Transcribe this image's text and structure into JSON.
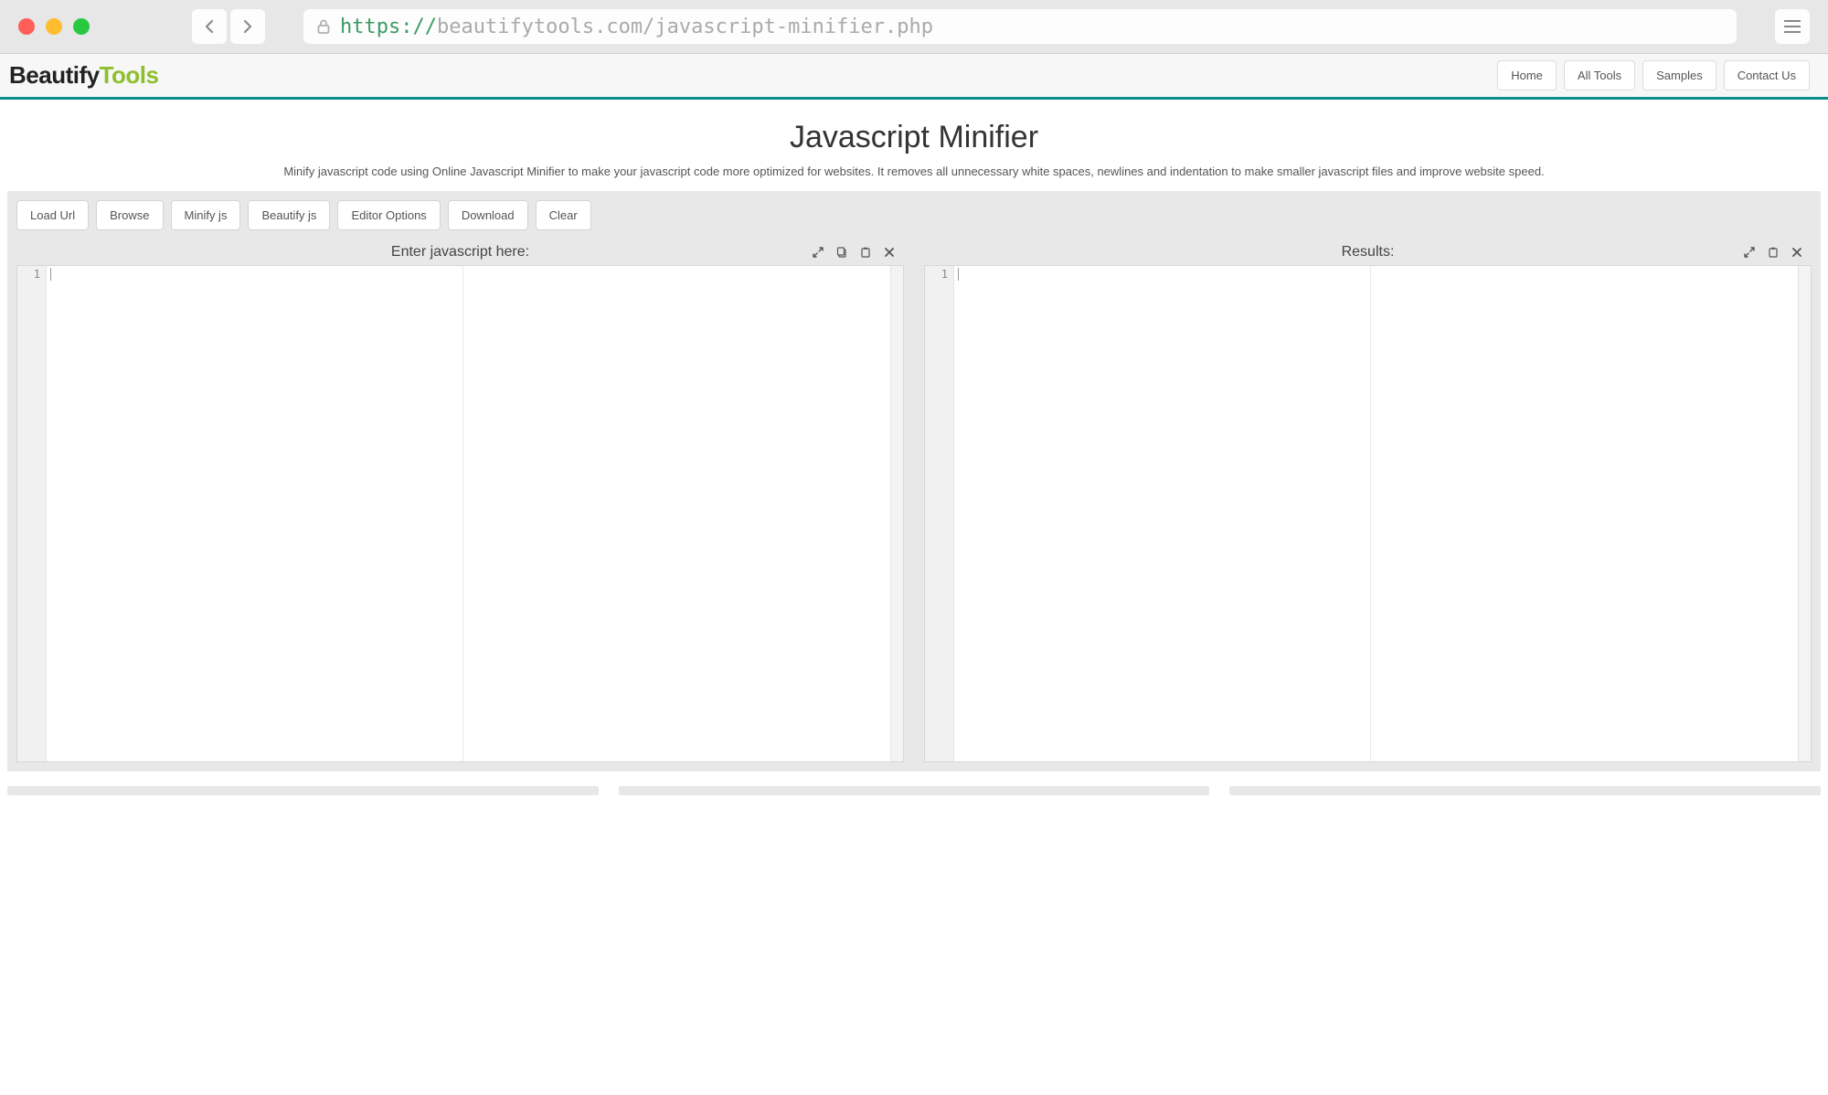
{
  "browser": {
    "url_protocol": "https://",
    "url_host_path": "beautifytools.com/javascript-minifier.php"
  },
  "header": {
    "logo_part1": "Beautify",
    "logo_part2": "Tools",
    "nav": [
      "Home",
      "All Tools",
      "Samples",
      "Contact Us"
    ]
  },
  "page": {
    "title": "Javascript Minifier",
    "description": "Minify javascript code using Online Javascript Minifier to make your javascript code more optimized for websites. It removes all unnecessary white spaces, newlines and indentation to make smaller javascript files and improve website speed."
  },
  "toolbar": {
    "buttons": [
      "Load Url",
      "Browse",
      "Minify js",
      "Beautify js",
      "Editor Options",
      "Download",
      "Clear"
    ]
  },
  "panels": {
    "input": {
      "label": "Enter javascript here:",
      "line_number": "1"
    },
    "output": {
      "label": "Results:",
      "line_number": "1"
    }
  }
}
